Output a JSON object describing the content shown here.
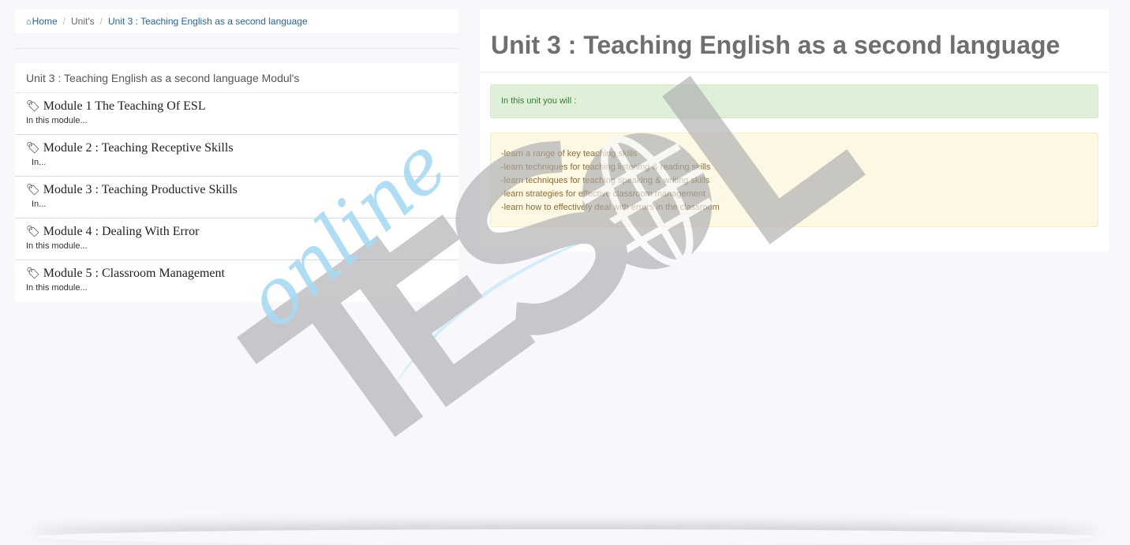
{
  "breadcrumb": {
    "home": "Home",
    "units": "Unit's",
    "current": "Unit 3 : Teaching English as a second language"
  },
  "modules_panel": {
    "heading": "Unit 3 : Teaching English as a second language Modul's",
    "items": [
      {
        "title": "Module 1 The Teaching Of ESL",
        "desc": "In this module..."
      },
      {
        "title": "Module 2 : Teaching Receptive Skills",
        "desc": "In..."
      },
      {
        "title": "Module 3 : Teaching Productive Skills",
        "desc": "In..."
      },
      {
        "title": "Module 4 : Dealing With Error",
        "desc": "In this module..."
      },
      {
        "title": "Module 5 : Classroom Management",
        "desc": "In this module..."
      }
    ]
  },
  "unit": {
    "title": "Unit 3 : Teaching English as a second language",
    "intro": "In this unit you will :",
    "objectives": [
      "-learn a range of key teaching skills",
      "-learn techniques for teaching listening & reading skills",
      "-learn techniques for teaching speaking & writing skills",
      "-learn strategies for effective classroom management",
      "-learn how to effectively deal with errors in the classroom"
    ]
  },
  "watermark": {
    "script_text": "online",
    "logo_text": "TESOL",
    "letter_color": "#a9a9ad",
    "swoosh_color": "#bfe3f5"
  },
  "icons": {
    "home": "home-icon",
    "module": "tag-icon"
  }
}
